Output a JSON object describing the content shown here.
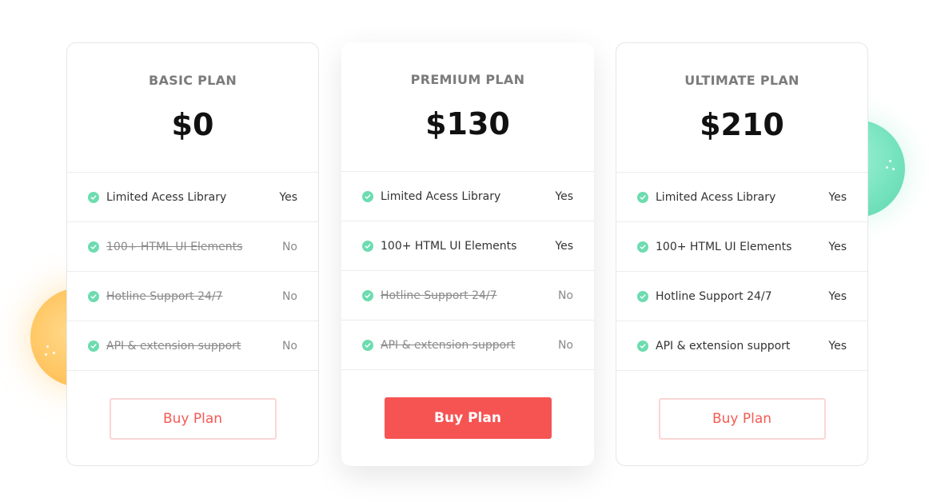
{
  "plans": [
    {
      "name": "BASIC PLAN",
      "price": "$0",
      "button_label": "Buy Plan",
      "features": [
        {
          "label": "Limited Acess Library",
          "value": "Yes",
          "included": true
        },
        {
          "label": "100+ HTML UI Elements",
          "value": "No",
          "included": false
        },
        {
          "label": "Hotline Support 24/7",
          "value": "No",
          "included": false
        },
        {
          "label": "API & extension support",
          "value": "No",
          "included": false
        }
      ]
    },
    {
      "name": "PREMIUM PLAN",
      "price": "$130",
      "button_label": "Buy Plan",
      "features": [
        {
          "label": "Limited Acess Library",
          "value": "Yes",
          "included": true
        },
        {
          "label": "100+ HTML UI Elements",
          "value": "Yes",
          "included": true
        },
        {
          "label": "Hotline Support 24/7",
          "value": "No",
          "included": false
        },
        {
          "label": "API & extension support",
          "value": "No",
          "included": false
        }
      ]
    },
    {
      "name": "ULTIMATE PLAN",
      "price": "$210",
      "button_label": "Buy Plan",
      "features": [
        {
          "label": "Limited Acess Library",
          "value": "Yes",
          "included": true
        },
        {
          "label": "100+ HTML UI Elements",
          "value": "Yes",
          "included": true
        },
        {
          "label": "Hotline Support 24/7",
          "value": "Yes",
          "included": true
        },
        {
          "label": "API & extension support",
          "value": "Yes",
          "included": true
        }
      ]
    }
  ],
  "colors": {
    "accent": "#f55453",
    "check": "#6ddcb0",
    "blob_orange": "#ffc561",
    "blob_green": "#74e2bd"
  },
  "icons": {
    "feature": "check-circle-icon"
  }
}
